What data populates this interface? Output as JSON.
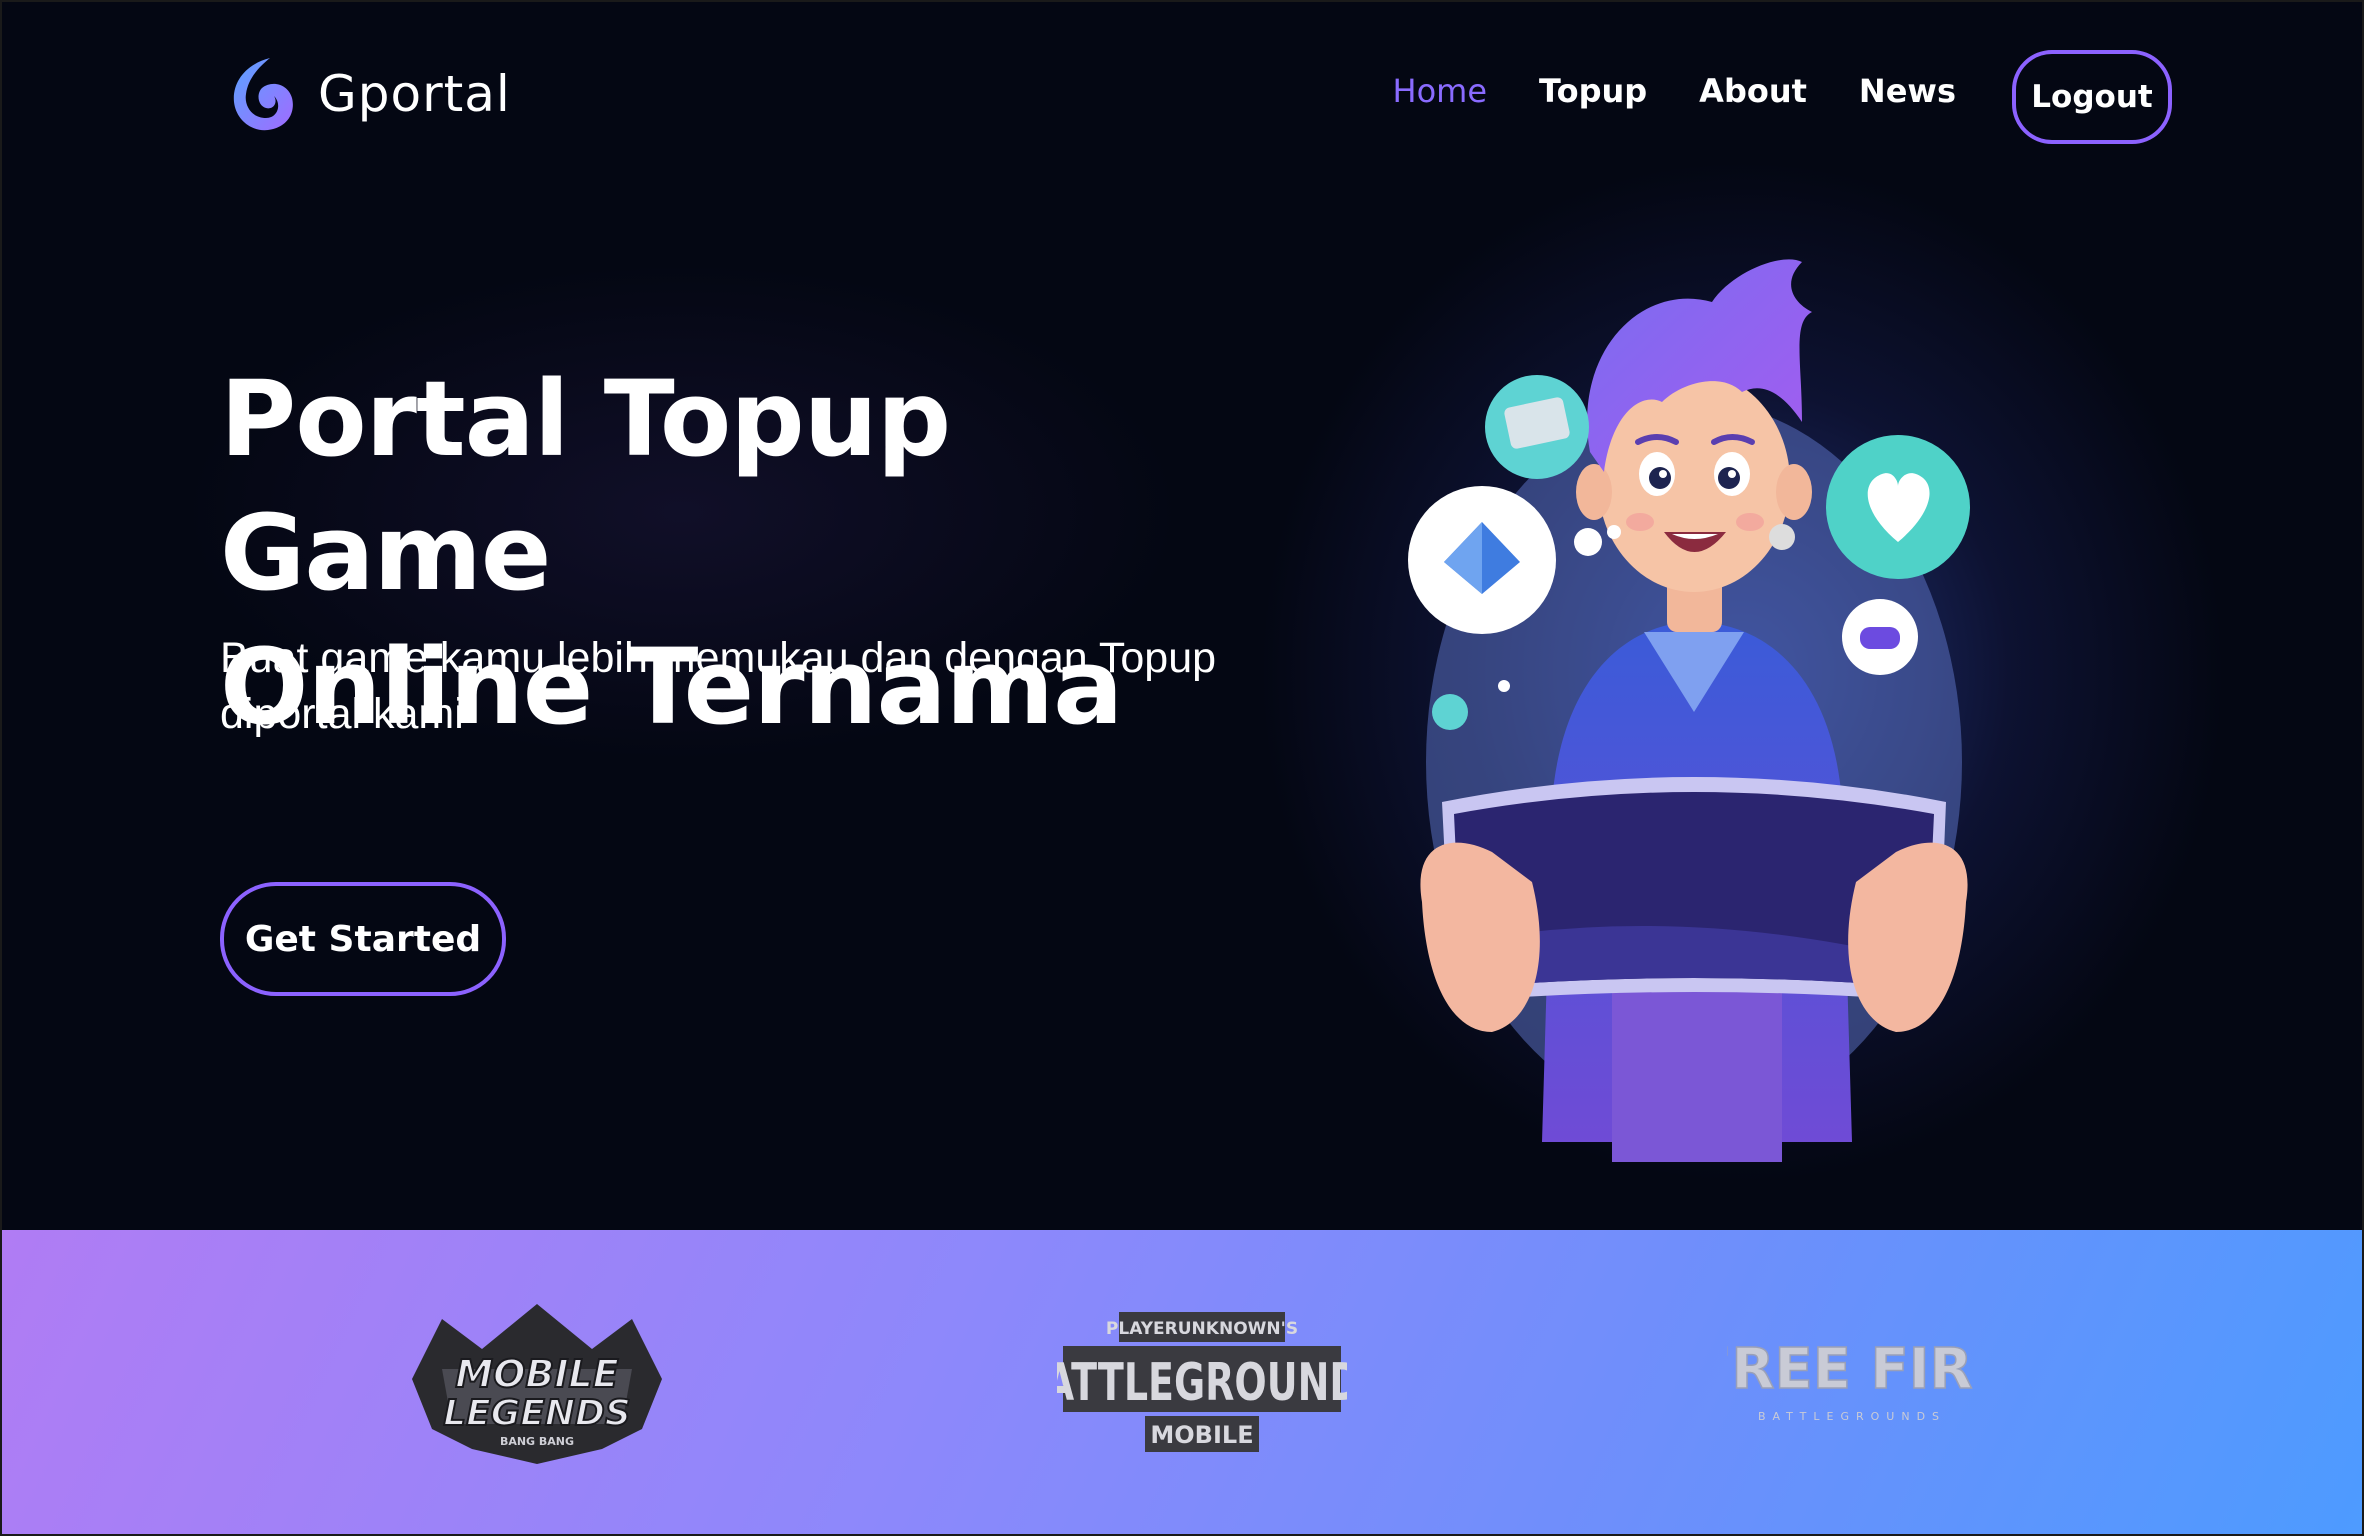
{
  "brand": {
    "name": "Gportal"
  },
  "nav": {
    "items": [
      {
        "label": "Home",
        "active": true
      },
      {
        "label": "Topup",
        "active": false
      },
      {
        "label": "About",
        "active": false
      },
      {
        "label": "News",
        "active": false
      }
    ],
    "logout_label": "Logout"
  },
  "hero": {
    "title_line1": "Portal Topup Game",
    "title_line2": "Online Ternama",
    "subtitle_line1": "Buat game kamu lebih memukau dan dengan Topup",
    "subtitle_line2": "diportal kami",
    "cta_label": "Get Started"
  },
  "games": {
    "mobile_legends": {
      "line1": "MOBILE",
      "line2": "LEGENDS",
      "line3": "BANG BANG"
    },
    "pubg": {
      "line1": "PLAYERUNKNOWN'S",
      "line2": "BATTLEGROUNDS",
      "line3": "MOBILE"
    },
    "free_fire": {
      "line1": "FREE FIRE",
      "line2": "BATTLEGROUNDS"
    }
  },
  "colors": {
    "hero_bg": "#040713",
    "accent_purple": "#8c62ff",
    "band_start": "#b07cf4",
    "band_end": "#4d9bff"
  }
}
